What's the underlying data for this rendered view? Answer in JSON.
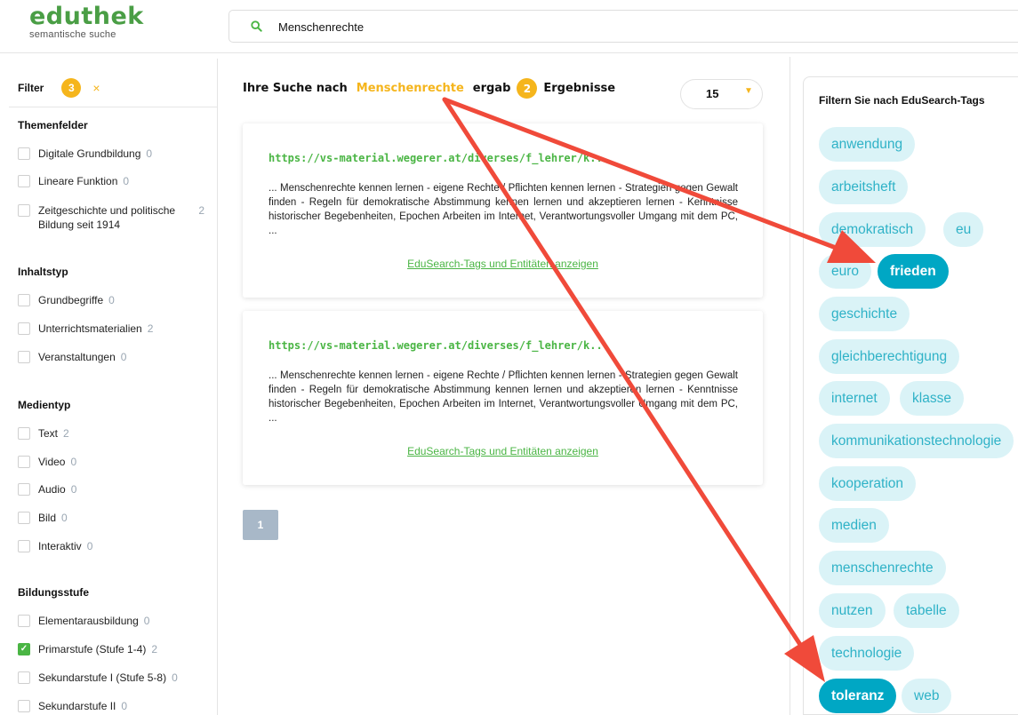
{
  "header": {
    "logo_name": "eduthek",
    "logo_tagline": "semantische suche",
    "search_value": "Menschenrechte"
  },
  "sidebar": {
    "filter_label": "Filter",
    "filter_count": "3",
    "clear_icon": "×",
    "sections": [
      {
        "title": "Themenfelder",
        "items": [
          {
            "label": "Digitale Grundbildung",
            "count": "0",
            "checked": false
          },
          {
            "label": "Lineare Funktion",
            "count": "0",
            "checked": false
          },
          {
            "label": "Zeitgeschichte und politische Bildung seit 1914",
            "count": "2",
            "checked": false
          }
        ]
      },
      {
        "title": "Inhaltstyp",
        "items": [
          {
            "label": "Grundbegriffe",
            "count": "0",
            "checked": false
          },
          {
            "label": "Unterrichtsmaterialien",
            "count": "2",
            "checked": false
          },
          {
            "label": "Veranstaltungen",
            "count": "0",
            "checked": false
          }
        ]
      },
      {
        "title": "Medientyp",
        "items": [
          {
            "label": "Text",
            "count": "2",
            "checked": false
          },
          {
            "label": "Video",
            "count": "0",
            "checked": false
          },
          {
            "label": "Audio",
            "count": "0",
            "checked": false
          },
          {
            "label": "Bild",
            "count": "0",
            "checked": false
          },
          {
            "label": "Interaktiv",
            "count": "0",
            "checked": false
          }
        ]
      },
      {
        "title": "Bildungsstufe",
        "items": [
          {
            "label": "Elementarausbildung",
            "count": "0",
            "checked": false
          },
          {
            "label": "Primarstufe (Stufe 1-4)",
            "count": "2",
            "checked": true
          },
          {
            "label": "Sekundarstufe I (Stufe 5-8)",
            "count": "0",
            "checked": false
          },
          {
            "label": "Sekundarstufe II",
            "count": "0",
            "checked": false
          }
        ]
      }
    ]
  },
  "results": {
    "prefix": "Ihre Suche nach",
    "query": "Menschenrechte",
    "middle": "ergab",
    "count": "2",
    "suffix": "Ergebnisse",
    "per_page": "15",
    "cards": [
      {
        "link": "https://vs-material.wegerer.at/diverses/f_lehrer/k...",
        "snippet": "... Menschenrechte kennen lernen - eigene Rechte / Pflichten kennen lernen - Strategien gegen Gewalt finden - Regeln für demokratische Abstimmung kennen lernen und akzeptieren lernen - Kenntnisse historischer Begebenheiten, Epochen Arbeiten im Internet, Verantwortungsvoller Umgang mit dem PC, ...",
        "tags_link": "EduSearch-Tags und Entitäten anzeigen"
      },
      {
        "link": "https://vs-material.wegerer.at/diverses/f_lehrer/k...",
        "snippet": "... Menschenrechte kennen lernen - eigene Rechte / Pflichten kennen lernen - Strategien gegen Gewalt finden - Regeln für demokratische Abstimmung kennen lernen und akzeptieren lernen - Kenntnisse historischer Begebenheiten, Epochen Arbeiten im Internet, Verantwortungsvoller Umgang mit dem PC, ...",
        "tags_link": "EduSearch-Tags und Entitäten anzeigen"
      }
    ],
    "page": "1"
  },
  "tags_panel": {
    "title": "Filtern Sie nach EduSearch-Tags",
    "tags": [
      {
        "label": "anwendung",
        "active": false
      },
      {
        "label": "arbeitsheft",
        "active": false
      },
      {
        "label": "demokratisch",
        "active": false
      },
      {
        "label": "eu",
        "active": false
      },
      {
        "label": "euro",
        "active": false
      },
      {
        "label": "frieden",
        "active": true
      },
      {
        "label": "geschichte",
        "active": false
      },
      {
        "label": "gleichberechtigung",
        "active": false
      },
      {
        "label": "internet",
        "active": false
      },
      {
        "label": "klasse",
        "active": false
      },
      {
        "label": "kommunikationstechnologie",
        "active": false
      },
      {
        "label": "kooperation",
        "active": false
      },
      {
        "label": "medien",
        "active": false
      },
      {
        "label": "menschenrechte",
        "active": false
      },
      {
        "label": "nutzen",
        "active": false
      },
      {
        "label": "tabelle",
        "active": false
      },
      {
        "label": "technologie",
        "active": false
      },
      {
        "label": "toleranz",
        "active": true
      },
      {
        "label": "web",
        "active": false
      }
    ]
  },
  "icons": {
    "search": "search-icon",
    "clear": "close-icon",
    "dropdown": "chevron-down-icon",
    "annotation": "arrow-icon"
  },
  "colors": {
    "brand_green": "#4a9e45",
    "accent_orange": "#f5b51c",
    "tag_bg": "#daf3f7",
    "tag_text": "#2fb2c7",
    "tag_active": "#00a7c4",
    "annotation_red": "#f04a3a"
  }
}
